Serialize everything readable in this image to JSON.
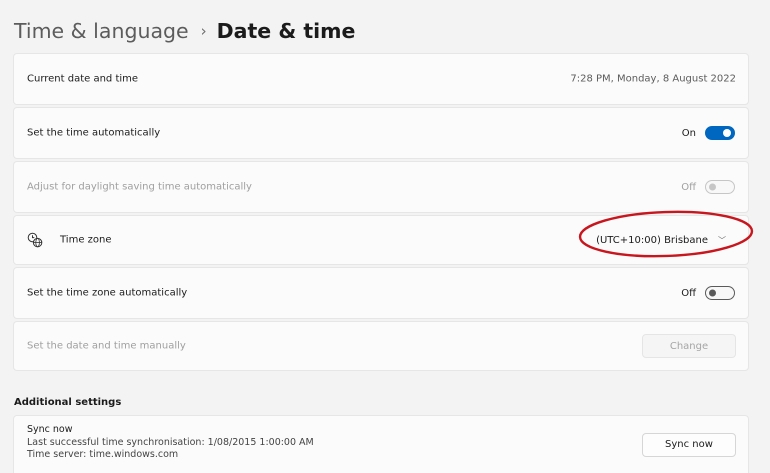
{
  "breadcrumb": {
    "parent": "Time & language",
    "separator": "›",
    "current": "Date & time"
  },
  "rows": {
    "current": {
      "label": "Current date and time",
      "value": "7:28 PM, Monday, 8 August 2022"
    },
    "auto_time": {
      "label": "Set the time automatically",
      "state": "On",
      "enabled": true
    },
    "dst": {
      "label": "Adjust for daylight saving time automatically",
      "state": "Off",
      "disabled": true
    },
    "timezone": {
      "label": "Time zone",
      "icon": "globe-clock-icon",
      "selected": "(UTC+10:00) Brisbane"
    },
    "auto_timezone": {
      "label": "Set the time zone automatically",
      "state": "Off"
    },
    "manual": {
      "label": "Set the date and time manually",
      "button_label": "Change",
      "disabled": true
    }
  },
  "additional": {
    "header": "Additional settings",
    "sync": {
      "title": "Sync now",
      "last_sync": "Last successful time synchronisation: 1/08/2015 1:00:00 AM",
      "server": "Time server: time.windows.com",
      "button_label": "Sync now"
    }
  },
  "colors": {
    "accent": "#0067c0",
    "annotation": "#c8161e",
    "background": "#f3f3f3",
    "card": "#fbfbfb"
  }
}
